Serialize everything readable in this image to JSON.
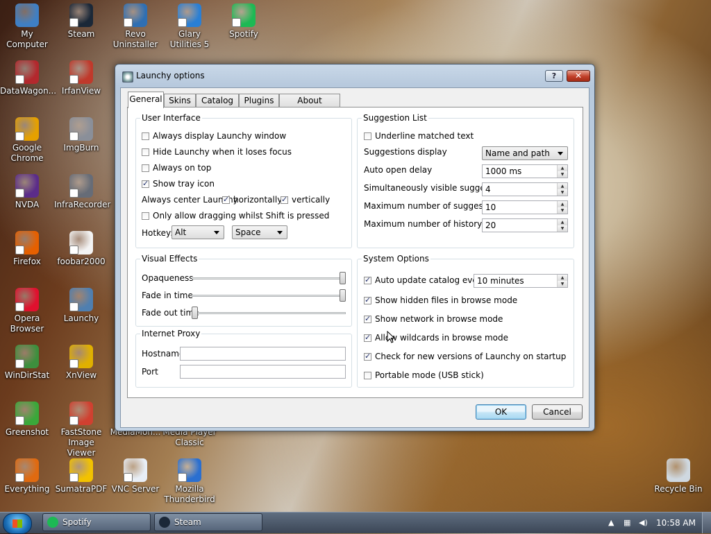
{
  "desktop": {
    "icons": [
      {
        "label": "My Computer",
        "icon": "computer-icon",
        "color": "#3f7fc4"
      },
      {
        "label": "Steam",
        "icon": "steam-icon",
        "color": "#1b2838"
      },
      {
        "label": "Revo Uninstaller",
        "icon": "revo-uninstaller-icon",
        "color": "#2f6fb3"
      },
      {
        "label": "Glary Utilities 5",
        "icon": "glary-utilities-icon",
        "color": "#2a7fd4"
      },
      {
        "label": "Spotify",
        "icon": "spotify-icon",
        "color": "#1db954"
      },
      {
        "label": "DataWagon...",
        "icon": "datawagon-icon",
        "color": "#b3282d"
      },
      {
        "label": "IrfanView",
        "icon": "irfanview-icon",
        "color": "#c0392b"
      },
      {
        "label": "Google Chrome",
        "icon": "chrome-icon",
        "color": "#e5a000"
      },
      {
        "label": "ImgBurn",
        "icon": "imgburn-icon",
        "color": "#8a8f99"
      },
      {
        "label": "NVDA",
        "icon": "nvda-icon",
        "color": "#5b2c8a"
      },
      {
        "label": "InfraRecorder",
        "icon": "infrarecorder-icon",
        "color": "#666c77"
      },
      {
        "label": "Firefox",
        "icon": "firefox-icon",
        "color": "#e66000"
      },
      {
        "label": "foobar2000",
        "icon": "foobar2000-icon",
        "color": "#f3f3f3"
      },
      {
        "label": "Opera Browser",
        "icon": "opera-icon",
        "color": "#e0102e"
      },
      {
        "label": "Launchy",
        "icon": "launchy-icon",
        "color": "#4f7fb0"
      },
      {
        "label": "WinDirStat",
        "icon": "windirstat-icon",
        "color": "#3d8f3d"
      },
      {
        "label": "XnView",
        "icon": "xnview-icon",
        "color": "#e0b000"
      },
      {
        "label": "Greenshot",
        "icon": "greenshot-icon",
        "color": "#3aa83a"
      },
      {
        "label": "FastStone Image Viewer",
        "icon": "faststone-icon",
        "color": "#d04030"
      },
      {
        "label": "MediaMon...",
        "icon": "mediamonkey-icon",
        "color": "#777777"
      },
      {
        "label": "Media Player Classic",
        "icon": "media-player-classic-icon",
        "color": "#777777"
      },
      {
        "label": "Everything",
        "icon": "everything-icon",
        "color": "#e06a10"
      },
      {
        "label": "SumatraPDF",
        "icon": "sumatrapdf-icon",
        "color": "#f2c200"
      },
      {
        "label": "VNC Server",
        "icon": "vnc-server-icon",
        "color": "#e8eef6"
      },
      {
        "label": "Mozilla Thunderbird",
        "icon": "thunderbird-icon",
        "color": "#2a6fd0"
      },
      {
        "label": "Recycle Bin",
        "icon": "recycle-bin-icon",
        "color": "#cfd8e0"
      }
    ]
  },
  "window": {
    "title": "Launchy options",
    "help_label": "?",
    "close_label": "✕",
    "tabs": [
      "General",
      "Skins",
      "Catalog",
      "Plugins",
      "About Launchy"
    ],
    "active_tab": "General",
    "user_interface": {
      "title": "User Interface",
      "always_display": {
        "label": "Always display Launchy window",
        "checked": false
      },
      "hide_focus": {
        "label": "Hide Launchy when it loses focus",
        "checked": false
      },
      "always_on_top": {
        "label": "Always on top",
        "checked": false
      },
      "show_tray": {
        "label": "Show tray icon",
        "checked": true
      },
      "center_label": "Always center Launchy",
      "horizontally": {
        "label": "horizontally",
        "checked": true
      },
      "vertically": {
        "label": "vertically",
        "checked": true
      },
      "drag_shift": {
        "label": "Only allow dragging whilst Shift is pressed",
        "checked": false
      },
      "hotkey_label": "Hotkey:",
      "hotkey_modifier": "Alt",
      "hotkey_key": "Space"
    },
    "suggestion_list": {
      "title": "Suggestion List",
      "underline": {
        "label": "Underline matched text",
        "checked": false
      },
      "display_label": "Suggestions display",
      "display_value": "Name and path",
      "auto_open_label": "Auto open delay",
      "auto_open_value": "1000 ms",
      "visible_label": "Simultaneously visible suggestions",
      "visible_value": "4",
      "max_sugg_label": "Maximum number of suggestions",
      "max_sugg_value": "10",
      "max_hist_label": "Maximum number of history items",
      "max_hist_value": "20"
    },
    "visual_effects": {
      "title": "Visual Effects",
      "opaqueness_label": "Opaqueness",
      "opaqueness_value": 1.0,
      "fade_in_label": "Fade in time",
      "fade_in_value": 1.0,
      "fade_out_label": "Fade out time",
      "fade_out_value": 0.0
    },
    "internet_proxy": {
      "title": "Internet Proxy",
      "hostname_label": "Hostname",
      "hostname_value": "",
      "port_label": "Port",
      "port_value": ""
    },
    "system_options": {
      "title": "System Options",
      "auto_update": {
        "label": "Auto update catalog every",
        "checked": true
      },
      "auto_update_value": "10 minutes",
      "hidden_files": {
        "label": "Show hidden files in browse mode",
        "checked": true
      },
      "show_network": {
        "label": "Show network in browse mode",
        "checked": true
      },
      "wildcards": {
        "label": "Allow wildcards in browse mode",
        "checked": true
      },
      "check_versions": {
        "label": "Check for new versions of Launchy on startup",
        "checked": true
      },
      "portable": {
        "label": "Portable mode (USB stick)",
        "checked": false
      }
    },
    "ok_label": "OK",
    "cancel_label": "Cancel"
  },
  "taskbar": {
    "buttons": [
      {
        "label": "Spotify",
        "icon": "spotify-icon",
        "color": "#1db954"
      },
      {
        "label": "Steam",
        "icon": "steam-icon",
        "color": "#1b2838"
      }
    ],
    "clock": "10:58 AM"
  }
}
